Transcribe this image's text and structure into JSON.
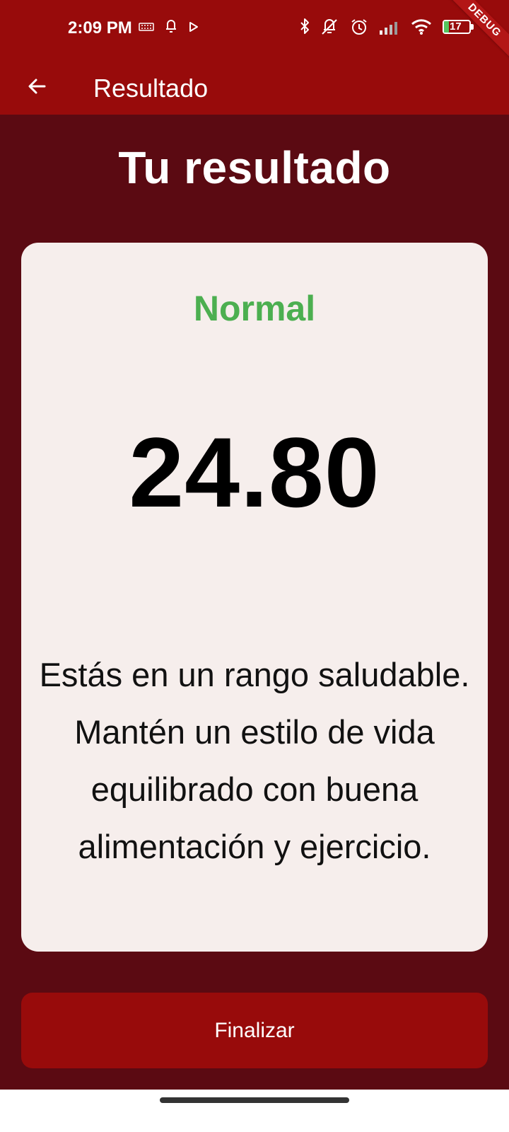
{
  "status_bar": {
    "time": "2:09 PM",
    "battery_level": "17",
    "left_icons": [
      "sim-card-icon",
      "notification-icon",
      "play-store-icon"
    ],
    "right_icons": [
      "bluetooth-icon",
      "mute-icon",
      "alarm-icon",
      "signal-icon",
      "wifi-icon",
      "battery-icon"
    ]
  },
  "debug_banner": "DEBUG",
  "app_bar": {
    "title": "Resultado",
    "back_icon": "arrow-left-icon"
  },
  "page": {
    "title": "Tu resultado"
  },
  "result": {
    "category": "Normal",
    "value": "24.80",
    "description": "Estás en un rango saludable. Mantén un estilo de vida equilibrado con buena alimentación y ejercicio."
  },
  "actions": {
    "finish_label": "Finalizar"
  },
  "colors": {
    "app_bar": "#980b0b",
    "background": "#5b0a12",
    "card": "#f6eeec",
    "category": "#4caf50",
    "button": "#980b0b"
  }
}
